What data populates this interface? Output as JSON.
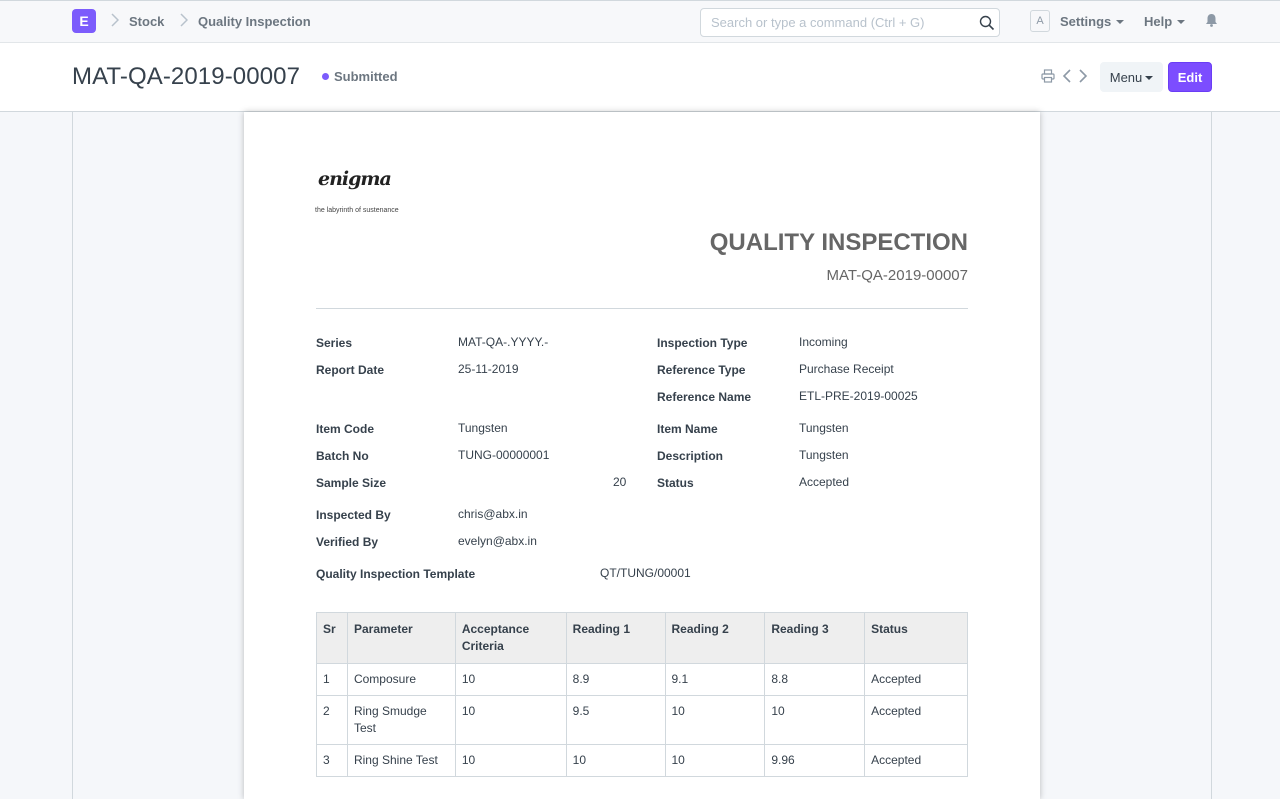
{
  "navbar": {
    "logo_letter": "E",
    "breadcrumbs": [
      "Stock",
      "Quality Inspection"
    ],
    "search_placeholder": "Search or type a command (Ctrl + G)",
    "avatar_letter": "A",
    "settings_label": "Settings",
    "help_label": "Help",
    "icons": [
      "search-icon",
      "bell-icon",
      "chevron-right-icon"
    ]
  },
  "page_head": {
    "title": "MAT-QA-2019-00007",
    "status": "Submitted",
    "status_color": "#7c5cfc",
    "menu_label": "Menu",
    "edit_label": "Edit",
    "accent_color": "#7c4dff"
  },
  "print": {
    "brand": {
      "logo_text": "enigma",
      "tagline": "the labyrinth of sustenance"
    },
    "heading": "QUALITY INSPECTION",
    "doc_name": "MAT-QA-2019-00007",
    "fields": {
      "series": {
        "label": "Series",
        "value": "MAT-QA-.YYYY.-"
      },
      "report_date": {
        "label": "Report Date",
        "value": "25-11-2019"
      },
      "inspection_type": {
        "label": "Inspection Type",
        "value": "Incoming"
      },
      "reference_type": {
        "label": "Reference Type",
        "value": "Purchase Receipt"
      },
      "reference_name": {
        "label": "Reference Name",
        "value": "ETL-PRE-2019-00025"
      },
      "item_code": {
        "label": "Item Code",
        "value": "Tungsten"
      },
      "batch_no": {
        "label": "Batch No",
        "value": "TUNG-00000001"
      },
      "sample_size": {
        "label": "Sample Size",
        "value": "20"
      },
      "item_name": {
        "label": "Item Name",
        "value": "Tungsten"
      },
      "description": {
        "label": "Description",
        "value": "Tungsten"
      },
      "status": {
        "label": "Status",
        "value": "Accepted"
      },
      "inspected_by": {
        "label": "Inspected By",
        "value": "chris@abx.in"
      },
      "verified_by": {
        "label": "Verified By",
        "value": "evelyn@abx.in"
      },
      "template": {
        "label": "Quality Inspection Template",
        "value": "QT/TUNG/00001"
      }
    },
    "table": {
      "headers": [
        "Sr",
        "Parameter",
        "Acceptance Criteria",
        "Reading 1",
        "Reading 2",
        "Reading 3",
        "Status"
      ],
      "rows": [
        [
          "1",
          "Composure",
          "10",
          "8.9",
          "9.1",
          "8.8",
          "Accepted"
        ],
        [
          "2",
          "Ring Smudge Test",
          "10",
          "9.5",
          "10",
          "10",
          "Accepted"
        ],
        [
          "3",
          "Ring Shine Test",
          "10",
          "10",
          "10",
          "9.96",
          "Accepted"
        ]
      ]
    }
  }
}
